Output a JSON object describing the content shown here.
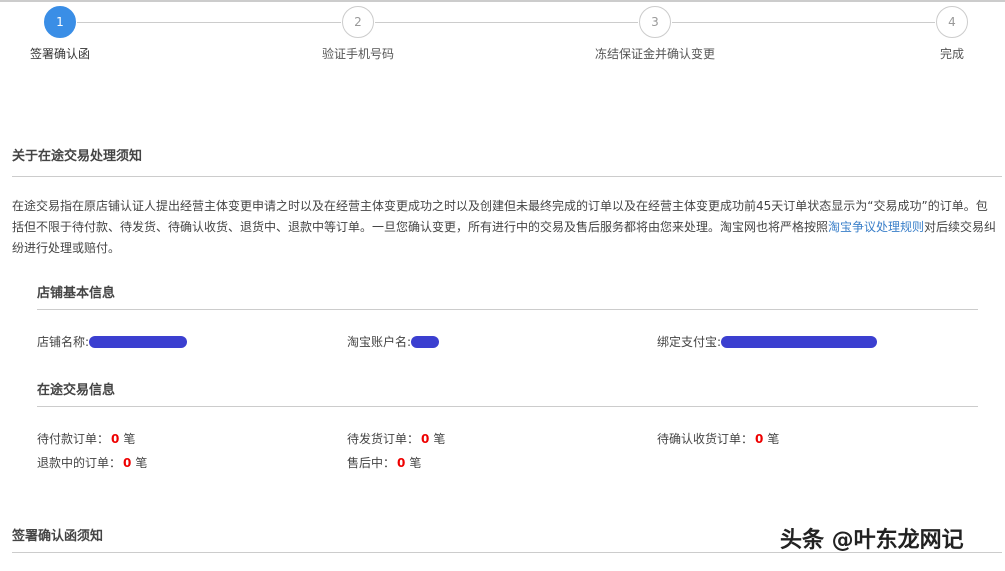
{
  "steps": [
    {
      "num": "1",
      "label": "签署确认函"
    },
    {
      "num": "2",
      "label": "验证手机号码"
    },
    {
      "num": "3",
      "label": "冻结保证金并确认变更"
    },
    {
      "num": "4",
      "label": "完成"
    }
  ],
  "notice": {
    "title": "关于在途交易处理须知",
    "text_before": "在途交易指在原店铺认证人提出经营主体变更申请之时以及在经营主体变更成功之时以及创建但未最终完成的订单以及在经营主体变更成功前45天订单状态显示为“交易成功”的订单。包括但不限于待付款、待发货、待确认收货、退货中、退款中等订单。一旦您确认变更，所有进行中的交易及售后服务都将由您来处理。淘宝网也将严格按照",
    "link": "淘宝争议处理规则",
    "text_after": "对后续交易纠纷进行处理或赔付。"
  },
  "shop": {
    "title": "店铺基本信息",
    "name_label": "店铺名称:",
    "account_label": "淘宝账户名:",
    "alipay_label": "绑定支付宝:"
  },
  "transit": {
    "title": "在途交易信息",
    "unit": "笔",
    "items": [
      {
        "label": "待付款订单：",
        "count": "0"
      },
      {
        "label": "待发货订单：",
        "count": "0"
      },
      {
        "label": "待确认收货订单：",
        "count": "0"
      },
      {
        "label": "退款中的订单：",
        "count": "0"
      },
      {
        "label": "售后中：",
        "count": "0"
      }
    ]
  },
  "letter": {
    "title": "签署确认函须知"
  },
  "watermark": "头条 @叶东龙网记",
  "colors": {
    "accent": "#3a8ee6",
    "count": "#e00000"
  }
}
